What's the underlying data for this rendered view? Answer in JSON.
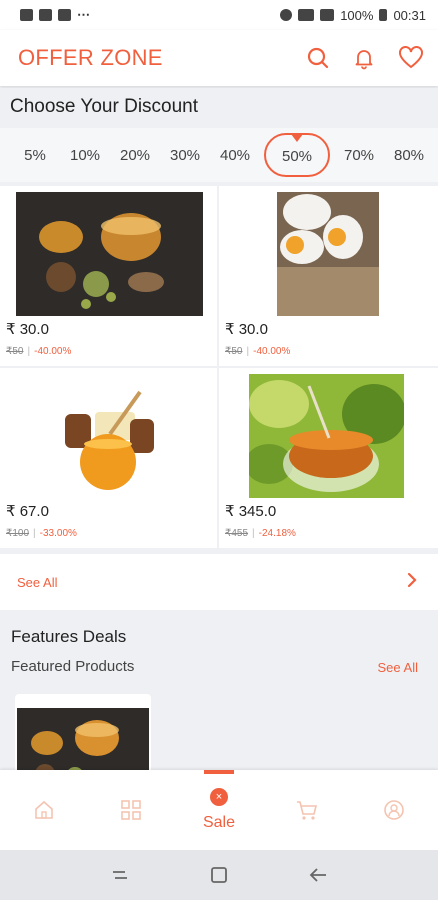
{
  "status_bar": {
    "battery": "100%",
    "time": "00:31",
    "more": "⋯"
  },
  "app_bar": {
    "title": "OFFER ZONE"
  },
  "discount": {
    "title": "Choose Your Discount",
    "options": [
      "5%",
      "10%",
      "20%",
      "30%",
      "40%",
      "50%",
      "70%",
      "80%"
    ],
    "selected": "50%"
  },
  "products": [
    {
      "price": "₹ 30.0",
      "mrp": "₹50",
      "discount": "-40.00%"
    },
    {
      "price": "₹ 30.0",
      "mrp": "₹50",
      "discount": "-40.00%"
    },
    {
      "price": "₹ 67.0",
      "mrp": "₹100",
      "discount": "-33.00%"
    },
    {
      "price": "₹ 345.0",
      "mrp": "₹455",
      "discount": "-24.18%"
    }
  ],
  "see_all": "See All",
  "features": {
    "title": "Features Deals",
    "subtitle": "Featured Products",
    "see_all": "See All"
  },
  "bottom_nav": {
    "sale_label": "Sale",
    "sale_badge": "×"
  },
  "colors": {
    "accent": "#f0603f"
  }
}
